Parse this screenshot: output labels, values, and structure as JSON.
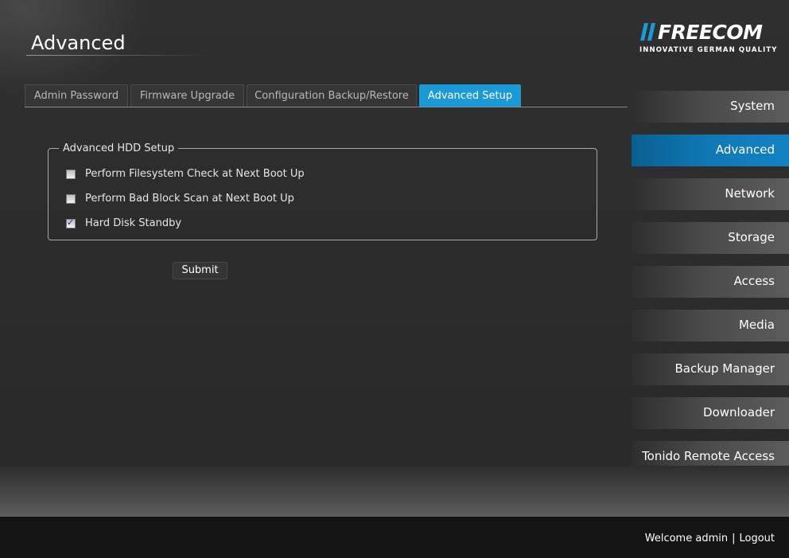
{
  "page": {
    "title": "Advanced"
  },
  "brand": {
    "name": "FREECOM",
    "tagline": "INNOVATIVE GERMAN QUALITY",
    "accent_color": "#1b9ad8"
  },
  "tabs": [
    {
      "label": "Admin Password",
      "active": false
    },
    {
      "label": "Firmware Upgrade",
      "active": false
    },
    {
      "label": "Configuration Backup/Restore",
      "active": false
    },
    {
      "label": "Advanced Setup",
      "active": true
    }
  ],
  "hdd_setup": {
    "legend": "Advanced HDD Setup",
    "options": [
      {
        "label": "Perform Filesystem Check at Next Boot Up",
        "checked": false
      },
      {
        "label": "Perform Bad Block Scan at Next Boot Up",
        "checked": false
      },
      {
        "label": "Hard Disk Standby",
        "checked": true
      }
    ],
    "submit_label": "Submit"
  },
  "sidebar": {
    "items": [
      {
        "label": "System",
        "active": false
      },
      {
        "label": "Advanced",
        "active": true
      },
      {
        "label": "Network",
        "active": false
      },
      {
        "label": "Storage",
        "active": false
      },
      {
        "label": "Access",
        "active": false
      },
      {
        "label": "Media",
        "active": false
      },
      {
        "label": "Backup Manager",
        "active": false
      },
      {
        "label": "Downloader",
        "active": false
      },
      {
        "label": "Tonido Remote Access",
        "active": false
      }
    ]
  },
  "footer": {
    "welcome": "Welcome admin",
    "separator": "|",
    "logout": "Logout"
  }
}
